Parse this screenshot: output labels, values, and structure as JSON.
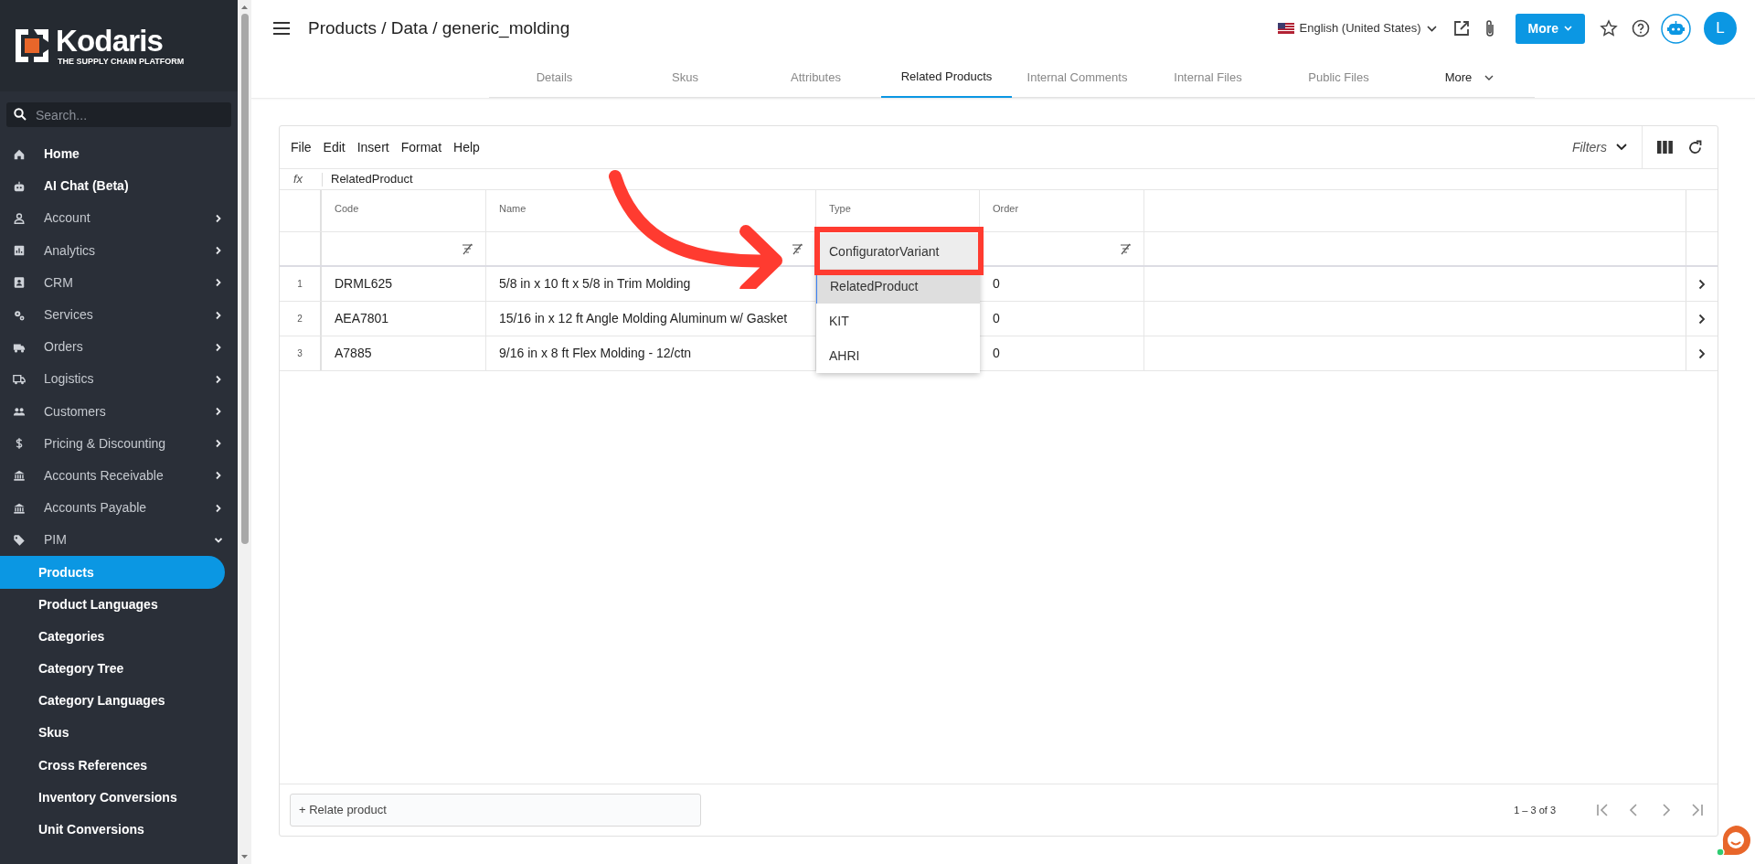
{
  "sidebar": {
    "logo": {
      "name": "Kodaris",
      "tagline": "THE SUPPLY CHAIN PLATFORM"
    },
    "search": {
      "placeholder": "Search..."
    },
    "items": [
      {
        "label": "Home",
        "kind": "link"
      },
      {
        "label": "AI Chat (Beta)",
        "kind": "link"
      },
      {
        "label": "Account",
        "kind": "group",
        "expanded": false
      },
      {
        "label": "Analytics",
        "kind": "group",
        "expanded": false
      },
      {
        "label": "CRM",
        "kind": "group",
        "expanded": false
      },
      {
        "label": "Services",
        "kind": "group",
        "expanded": false
      },
      {
        "label": "Orders",
        "kind": "group",
        "expanded": false
      },
      {
        "label": "Logistics",
        "kind": "group",
        "expanded": false
      },
      {
        "label": "Customers",
        "kind": "group",
        "expanded": false
      },
      {
        "label": "Pricing & Discounting",
        "kind": "group",
        "expanded": false
      },
      {
        "label": "Accounts Receivable",
        "kind": "group",
        "expanded": false
      },
      {
        "label": "Accounts Payable",
        "kind": "group",
        "expanded": false
      },
      {
        "label": "PIM",
        "kind": "group",
        "expanded": true,
        "children": [
          {
            "label": "Products",
            "selected": true
          },
          {
            "label": "Product Languages",
            "selected": false
          },
          {
            "label": "Categories",
            "selected": false
          },
          {
            "label": "Category Tree",
            "selected": false
          },
          {
            "label": "Category Languages",
            "selected": false
          },
          {
            "label": "Skus",
            "selected": false
          },
          {
            "label": "Cross References",
            "selected": false
          },
          {
            "label": "Inventory Conversions",
            "selected": false
          },
          {
            "label": "Unit Conversions",
            "selected": false
          }
        ]
      }
    ]
  },
  "header": {
    "breadcrumb": "Products / Data / generic_molding",
    "language": "English (United States)",
    "more_button": "More",
    "avatar": "L"
  },
  "tabs": [
    {
      "label": "Details",
      "kind": "tab",
      "selected": false
    },
    {
      "label": "Skus",
      "kind": "tab",
      "selected": false
    },
    {
      "label": "Attributes",
      "kind": "tab",
      "selected": false
    },
    {
      "label": "Related Products",
      "kind": "tab",
      "selected": true
    },
    {
      "label": "Internal Comments",
      "kind": "tab",
      "selected": false
    },
    {
      "label": "Internal Files",
      "kind": "tab",
      "selected": false
    },
    {
      "label": "Public Files",
      "kind": "tab",
      "selected": false
    },
    {
      "label": "More",
      "kind": "menu",
      "selected": false
    }
  ],
  "grid": {
    "menu": [
      "File",
      "Edit",
      "Insert",
      "Format",
      "Help"
    ],
    "filters": "Filters",
    "formula": {
      "label": "fx",
      "value": "RelatedProduct"
    },
    "columns": [
      "Code",
      "Name",
      "Type",
      "Order"
    ],
    "rows": [
      {
        "number": "1",
        "code": "DRML625",
        "name": "5/8 in x 10 ft x 5/8 in Trim Molding",
        "order": "0"
      },
      {
        "number": "2",
        "code": "AEA7801",
        "name": "15/16 in x 12 ft Angle Molding Aluminum w/ Gasket",
        "order": "0"
      },
      {
        "number": "3",
        "code": "A7885",
        "name": "9/16 in x 8 ft Flex Molding - 12/ctn",
        "order": "0"
      }
    ],
    "type_dropdown": {
      "options": [
        {
          "label": "ConfiguratorVariant",
          "highlighted": true,
          "selected": false
        },
        {
          "label": "RelatedProduct",
          "highlighted": false,
          "selected": true
        },
        {
          "label": "KIT",
          "highlighted": false,
          "selected": false
        },
        {
          "label": "AHRI",
          "highlighted": false,
          "selected": false
        }
      ]
    },
    "add_button": "+ Relate product",
    "pagination": "1 – 3 of 3"
  }
}
